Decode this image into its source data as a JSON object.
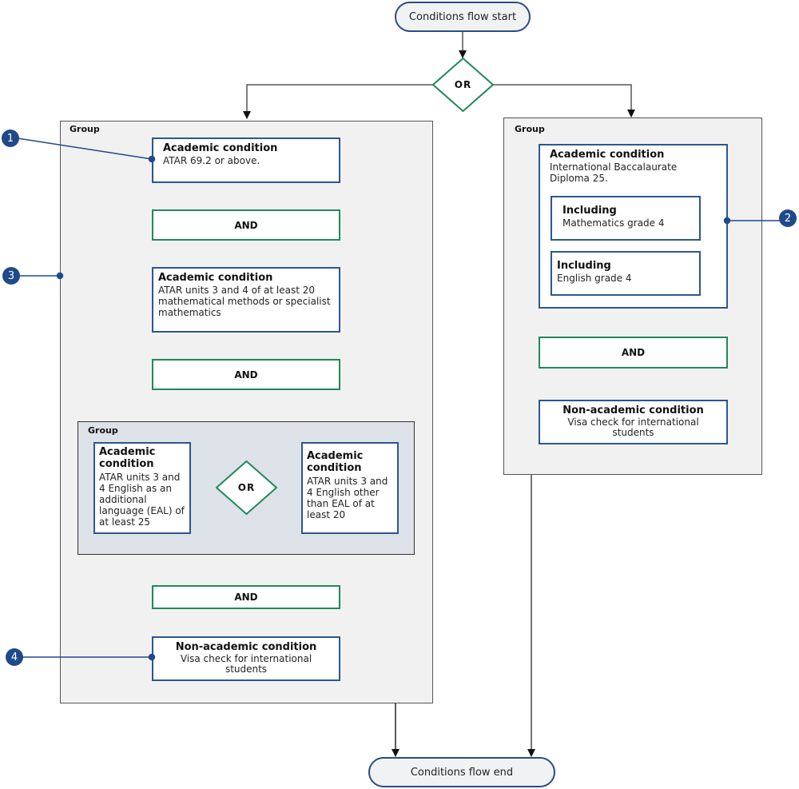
{
  "diagram": {
    "start": {
      "label": "Conditions flow start"
    },
    "end": {
      "label": "Conditions flow end"
    },
    "root_operator": {
      "label": "OR"
    },
    "colors": {
      "condition_border": "#2c5596",
      "operator_border": "#1f8a5a",
      "callout_fill": "#1f4a8a",
      "group_fill": "#f1f1f1",
      "inner_group_fill": "#dde1e8",
      "terminal_fill": "#f1f2f4"
    },
    "left_group": {
      "label": "Group",
      "condition_1": {
        "title": "Academic condition",
        "text": "ATAR 69.2  or above."
      },
      "and_1": {
        "label": "AND"
      },
      "condition_2": {
        "title": "Academic condition",
        "text": "ATAR units 3 and 4 of at least 20 mathematical methods or specialist mathematics"
      },
      "and_2": {
        "label": "AND"
      },
      "inner_group": {
        "label": "Group",
        "operator": {
          "label": "OR"
        },
        "condition_a": {
          "title": "Academic condition",
          "text": "ATAR units 3 and 4 English as an additional language (EAL) of at least 25"
        },
        "condition_b": {
          "title": "Academic condition",
          "text": "ATAR units 3 and 4  English other than EAL of at least 20"
        }
      },
      "and_3": {
        "label": "AND"
      },
      "non_academic": {
        "title": "Non-academic condition",
        "text": "Visa check for international students"
      }
    },
    "right_group": {
      "label": "Group",
      "condition": {
        "title": "Academic condition",
        "text": "International Baccalaurate Diploma 25.",
        "including": [
          {
            "title": "Including",
            "text": "Mathematics grade 4"
          },
          {
            "title": "Including",
            "text": "English grade 4"
          }
        ]
      },
      "and_1": {
        "label": "AND"
      },
      "non_academic": {
        "title": "Non-academic condition",
        "text": "Visa check for international students"
      }
    },
    "callouts": [
      "1",
      "2",
      "3",
      "4"
    ]
  }
}
